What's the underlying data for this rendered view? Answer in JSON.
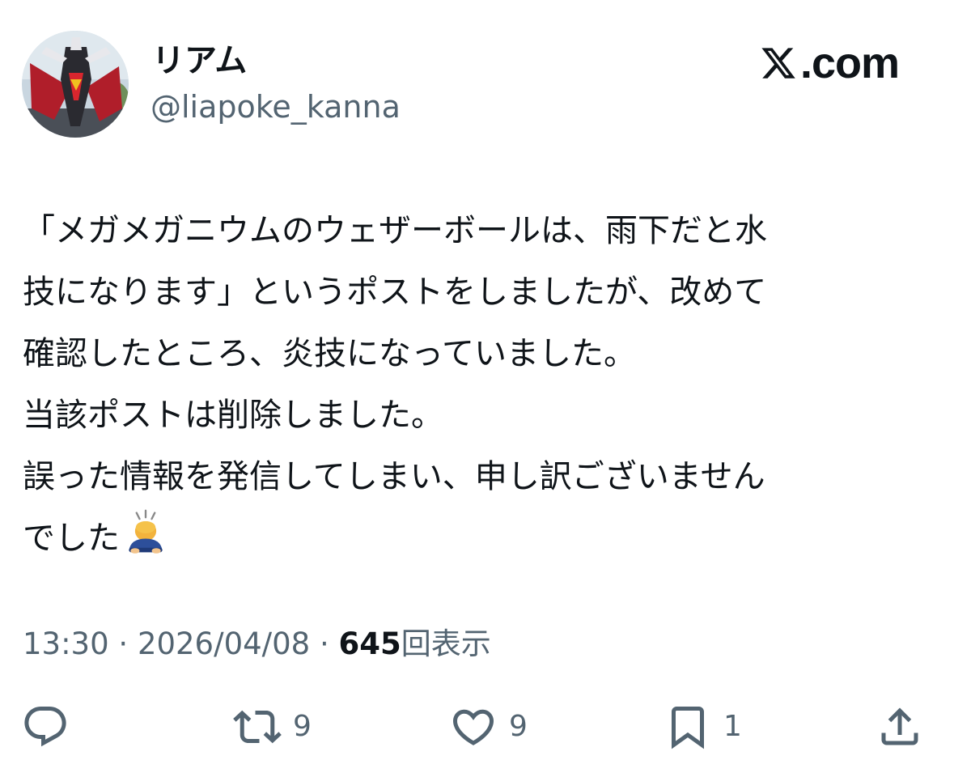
{
  "header": {
    "display_name": "リアム",
    "handle": "@liapoke_kanna",
    "brand_text": ".com"
  },
  "post": {
    "lines": [
      "「メガメガニウムのウェザーボールは、雨下だと水",
      "技になります」というポストをしましたが、改めて",
      "確認したところ、炎技になっていました。",
      "当該ポストは削除しました。",
      "誤った情報を発信してしまい、申し訳ございません",
      "でした"
    ],
    "emoji": "person-bowing-emoji"
  },
  "meta": {
    "time": "13:30",
    "separator": "·",
    "date": "2026/04/08",
    "views_count": "645",
    "views_label": "回表示"
  },
  "actions": {
    "reply": {
      "icon": "reply-icon",
      "count": ""
    },
    "repost": {
      "icon": "repost-icon",
      "count": "9"
    },
    "like": {
      "icon": "heart-icon",
      "count": "9"
    },
    "bookmark": {
      "icon": "bookmark-icon",
      "count": "1"
    },
    "share": {
      "icon": "share-icon",
      "count": ""
    }
  },
  "colors": {
    "text_primary": "#0f1419",
    "text_secondary": "#536471",
    "background": "#ffffff"
  }
}
